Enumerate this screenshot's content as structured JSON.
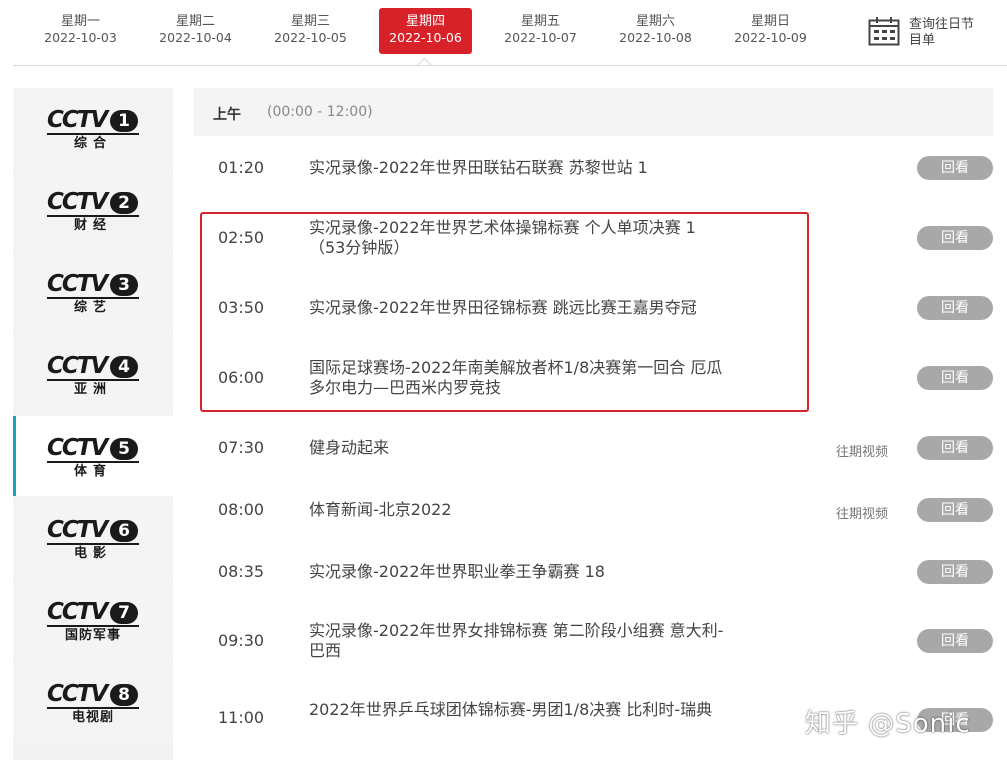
{
  "dates": [
    {
      "weekday": "星期一",
      "date": "2022-10-03"
    },
    {
      "weekday": "星期二",
      "date": "2022-10-04"
    },
    {
      "weekday": "星期三",
      "date": "2022-10-05"
    },
    {
      "weekday": "星期四",
      "date": "2022-10-06"
    },
    {
      "weekday": "星期五",
      "date": "2022-10-07"
    },
    {
      "weekday": "星期六",
      "date": "2022-10-08"
    },
    {
      "weekday": "星期日",
      "date": "2022-10-09"
    }
  ],
  "active_date_index": 3,
  "history_link": {
    "label": "查询往日节目单",
    "icon": "calendar-icon"
  },
  "channels": [
    {
      "brand": "CCTV",
      "number": "1",
      "name": "综合"
    },
    {
      "brand": "CCTV",
      "number": "2",
      "name": "财经"
    },
    {
      "brand": "CCTV",
      "number": "3",
      "name": "综艺"
    },
    {
      "brand": "CCTV",
      "number": "4",
      "name": "亚洲"
    },
    {
      "brand": "CCTV",
      "number": "5",
      "name": "体育"
    },
    {
      "brand": "CCTV",
      "number": "6",
      "name": "电影"
    },
    {
      "brand": "CCTV",
      "number": "7",
      "name": "国防军事"
    },
    {
      "brand": "CCTV",
      "number": "8",
      "name": "电视剧"
    }
  ],
  "active_channel_index": 4,
  "period": {
    "name": "上午",
    "range": "(00:00 - 12:00)"
  },
  "programs": [
    {
      "time": "01:20",
      "title": "实况录像-2022年世界田联钻石联赛 苏黎世站 1",
      "past": "",
      "replay": "回看"
    },
    {
      "time": "02:50",
      "title": "实况录像-2022年世界艺术体操锦标赛 个人单项决赛 1（53分钟版）",
      "past": "",
      "replay": "回看"
    },
    {
      "time": "03:50",
      "title": "实况录像-2022年世界田径锦标赛 跳远比赛王嘉男夺冠",
      "past": "",
      "replay": "回看"
    },
    {
      "time": "06:00",
      "title": "国际足球赛场-2022年南美解放者杯1/8决赛第一回合 厄瓜多尔电力—巴西米内罗竞技",
      "past": "",
      "replay": "回看"
    },
    {
      "time": "07:30",
      "title": "健身动起来",
      "past": "往期视频",
      "replay": "回看"
    },
    {
      "time": "08:00",
      "title": "体育新闻-北京2022",
      "past": "往期视频",
      "replay": "回看"
    },
    {
      "time": "08:35",
      "title": "实况录像-2022年世界职业拳王争霸赛 18",
      "past": "",
      "replay": "回看"
    },
    {
      "time": "09:30",
      "title": "实况录像-2022年世界女排锦标赛 第二阶段小组赛 意大利-巴西",
      "past": "",
      "replay": "回看"
    },
    {
      "time": "11:00",
      "title": "2022年世界乒乓球团体锦标赛-男团1/8决赛 比利时-瑞典",
      "past": "",
      "replay": "回看"
    }
  ],
  "watermark": "知乎 @Sonic",
  "colors": {
    "accent": "#d8222a",
    "active_channel_border": "#1aa3b8",
    "replay_button": "#a8a8a8"
  }
}
